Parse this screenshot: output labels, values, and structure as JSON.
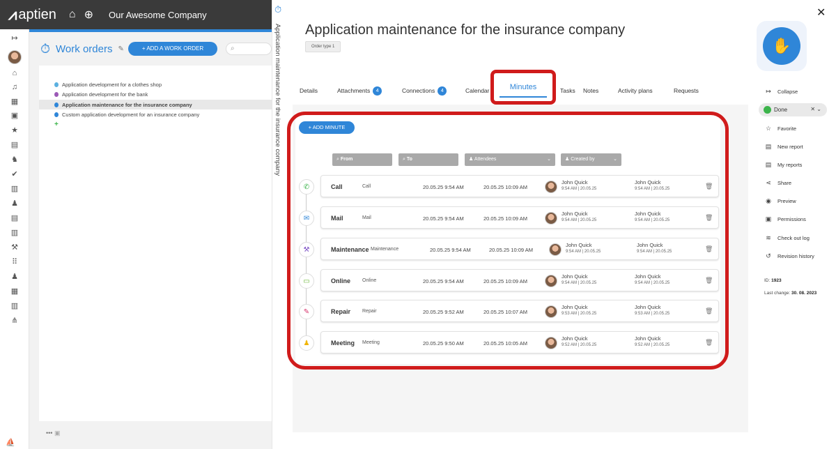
{
  "app": {
    "logo": "aptien",
    "company": "Our Awesome Company"
  },
  "left": {
    "section_title": "Work orders",
    "add_button": "+ ADD A WORK ORDER",
    "items": [
      {
        "label": "Application development for a clothes shop",
        "color": "#5bb0e0"
      },
      {
        "label": "Application development for the bank",
        "color": "#9b59b6"
      },
      {
        "label": "Application maintenance for the insurance company",
        "color": "#2f86d8"
      },
      {
        "label": "Custom application development for an insurance company",
        "color": "#2f86d8"
      }
    ],
    "plus_symbol": "+",
    "bottom_dots": "•••"
  },
  "vertical_title": "Application maintenance for the insurance company",
  "header": {
    "title": "Application maintenance for the insurance company",
    "order_type": "Order type 1"
  },
  "tabs": [
    {
      "label": "Details"
    },
    {
      "label": "Attachments",
      "badge": "4"
    },
    {
      "label": "Connections",
      "badge": "4"
    },
    {
      "label": "Calendar"
    },
    {
      "label": "Minutes",
      "active": true
    },
    {
      "label": "Tasks"
    },
    {
      "label": "Notes"
    },
    {
      "label": "Activity plans"
    },
    {
      "label": "Requests"
    }
  ],
  "minutes": {
    "add_button": "+ ADD MINUTE",
    "filters": {
      "from": "From",
      "to": "To",
      "attendees": "Attendees",
      "created_by": "Created by"
    },
    "rows": [
      {
        "name": "Call",
        "type": "Call",
        "from": "20.05.25 9:54 AM",
        "to": "20.05.25 10:09 AM",
        "p1": "John Quick",
        "p1_sub": "9:54 AM | 20.05.25",
        "p2": "John Quick",
        "p2_sub": "9:54 AM | 20.05.25",
        "icon": "phone-icon",
        "icon_color": "#3cb44b",
        "glyph": "✆"
      },
      {
        "name": "Mail",
        "type": "Mail",
        "from": "20.05.25 9:54 AM",
        "to": "20.05.25 10:09 AM",
        "p1": "John Quick",
        "p1_sub": "9:54 AM | 20.05.25",
        "p2": "John Quick",
        "p2_sub": "9:54 AM | 20.05.25",
        "icon": "mail-icon",
        "icon_color": "#2f86d8",
        "glyph": "✉"
      },
      {
        "name": "Maintenance",
        "type": "Maintenance",
        "from": "20.05.25 9:54 AM",
        "to": "20.05.25 10:09 AM",
        "p1": "John Quick",
        "p1_sub": "9:54 AM | 20.05.25",
        "p2": "John Quick",
        "p2_sub": "9:54 AM | 20.05.25",
        "icon": "toolbox-icon",
        "icon_color": "#7b4fc4",
        "glyph": "⚒"
      },
      {
        "name": "Online",
        "type": "Online",
        "from": "20.05.25 9:54 AM",
        "to": "20.05.25 10:09 AM",
        "p1": "John Quick",
        "p1_sub": "9:54 AM | 20.05.25",
        "p2": "John Quick",
        "p2_sub": "9:54 AM | 20.05.25",
        "icon": "monitor-icon",
        "icon_color": "#6cb83a",
        "glyph": "▭"
      },
      {
        "name": "Repair",
        "type": "Repair",
        "from": "20.05.25 9:52 AM",
        "to": "20.05.25 10:07 AM",
        "p1": "John Quick",
        "p1_sub": "9:53 AM | 20.05.25",
        "p2": "John Quick",
        "p2_sub": "9:53 AM | 20.05.25",
        "icon": "wrench-icon",
        "icon_color": "#d6336c",
        "glyph": "🔧"
      },
      {
        "name": "Meeting",
        "type": "Meeting",
        "from": "20.05.25 9:50 AM",
        "to": "20.05.25 10:05 AM",
        "p1": "John Quick",
        "p1_sub": "9:52 AM | 20.05.25",
        "p2": "John Quick",
        "p2_sub": "9:52 AM | 20.05.25",
        "icon": "group-icon",
        "icon_color": "#f0b400",
        "glyph": "👥"
      }
    ]
  },
  "sidebar": {
    "collapse": "Collapse",
    "status": "Done",
    "items": [
      {
        "label": "Favorite",
        "icon": "star-icon",
        "glyph": "☆"
      },
      {
        "label": "New report",
        "icon": "report-icon",
        "glyph": "▤"
      },
      {
        "label": "My reports",
        "icon": "reports-icon",
        "glyph": "▤"
      },
      {
        "label": "Share",
        "icon": "share-icon",
        "glyph": "⋖"
      },
      {
        "label": "Preview",
        "icon": "eye-icon",
        "glyph": "◉"
      },
      {
        "label": "Permissions",
        "icon": "key-icon",
        "glyph": "▣"
      },
      {
        "label": "Check out log",
        "icon": "log-icon",
        "glyph": "≋"
      },
      {
        "label": "Revision history",
        "icon": "history-icon",
        "glyph": "↺"
      }
    ],
    "id_label": "ID:",
    "id_value": "1923",
    "last_change_label": "Last change:",
    "last_change_value": "30. 08. 2023"
  }
}
